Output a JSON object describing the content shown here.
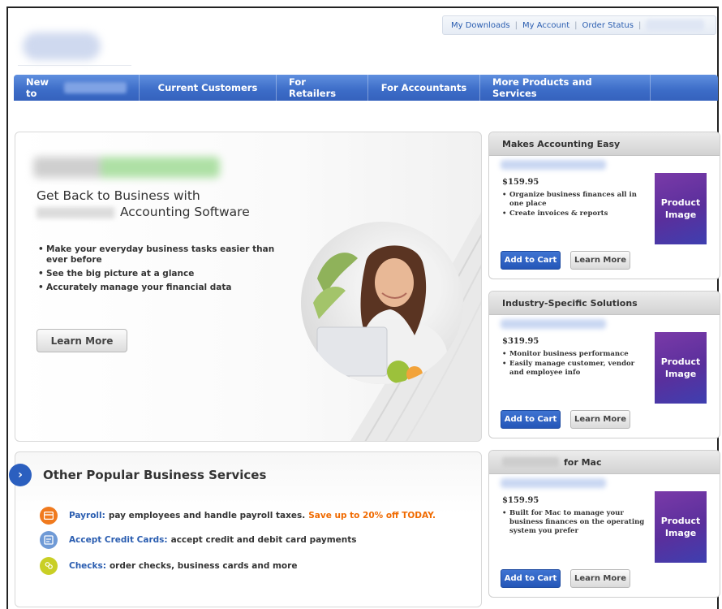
{
  "utility_nav": {
    "items": [
      "My Downloads",
      "My Account",
      "Order Status"
    ]
  },
  "main_nav": {
    "items": [
      "New to",
      "Current Customers",
      "For Retailers",
      "For Accountants",
      "More Products and Services"
    ]
  },
  "hero": {
    "title_line1": "Get Back to Business with",
    "title_line2": "Accounting Software",
    "bullets": [
      "Make your everyday business tasks easier than ever before",
      "See the big picture at a glance",
      "Accurately manage your financial data"
    ],
    "learn_more": "Learn More"
  },
  "products": [
    {
      "header": "Makes Accounting Easy",
      "price": "$159.95",
      "bullets": [
        "Organize business finances all in one place",
        "Create invoices & reports"
      ],
      "image_label": "Product Image",
      "add_to_cart": "Add to Cart",
      "learn_more": "Learn More"
    },
    {
      "header": "Industry-Specific Solutions",
      "price": "$319.95",
      "bullets": [
        "Monitor business performance",
        "Easily manage customer, vendor and employee info"
      ],
      "image_label": "Product Image",
      "add_to_cart": "Add to Cart",
      "learn_more": "Learn More"
    },
    {
      "header": "for Mac",
      "price": "$159.95",
      "bullets": [
        "Built for Mac to manage your business finances on the operating system you prefer"
      ],
      "image_label": "Product Image",
      "add_to_cart": "Add to Cart",
      "learn_more": "Learn More"
    }
  ],
  "services": {
    "title": "Other Popular Business Services",
    "items": [
      {
        "link": "Payroll:",
        "text": "pay employees and handle payroll taxes.",
        "promo": "Save up to 20% off TODAY.",
        "color": "#f07a1e"
      },
      {
        "link": "Accept Credit Cards:",
        "text": "accept credit and debit card payments",
        "promo": "",
        "color": "#6f9ad6"
      },
      {
        "link": "Checks:",
        "text": "order checks, business cards and more",
        "promo": "",
        "color": "#c9cf25"
      }
    ]
  }
}
